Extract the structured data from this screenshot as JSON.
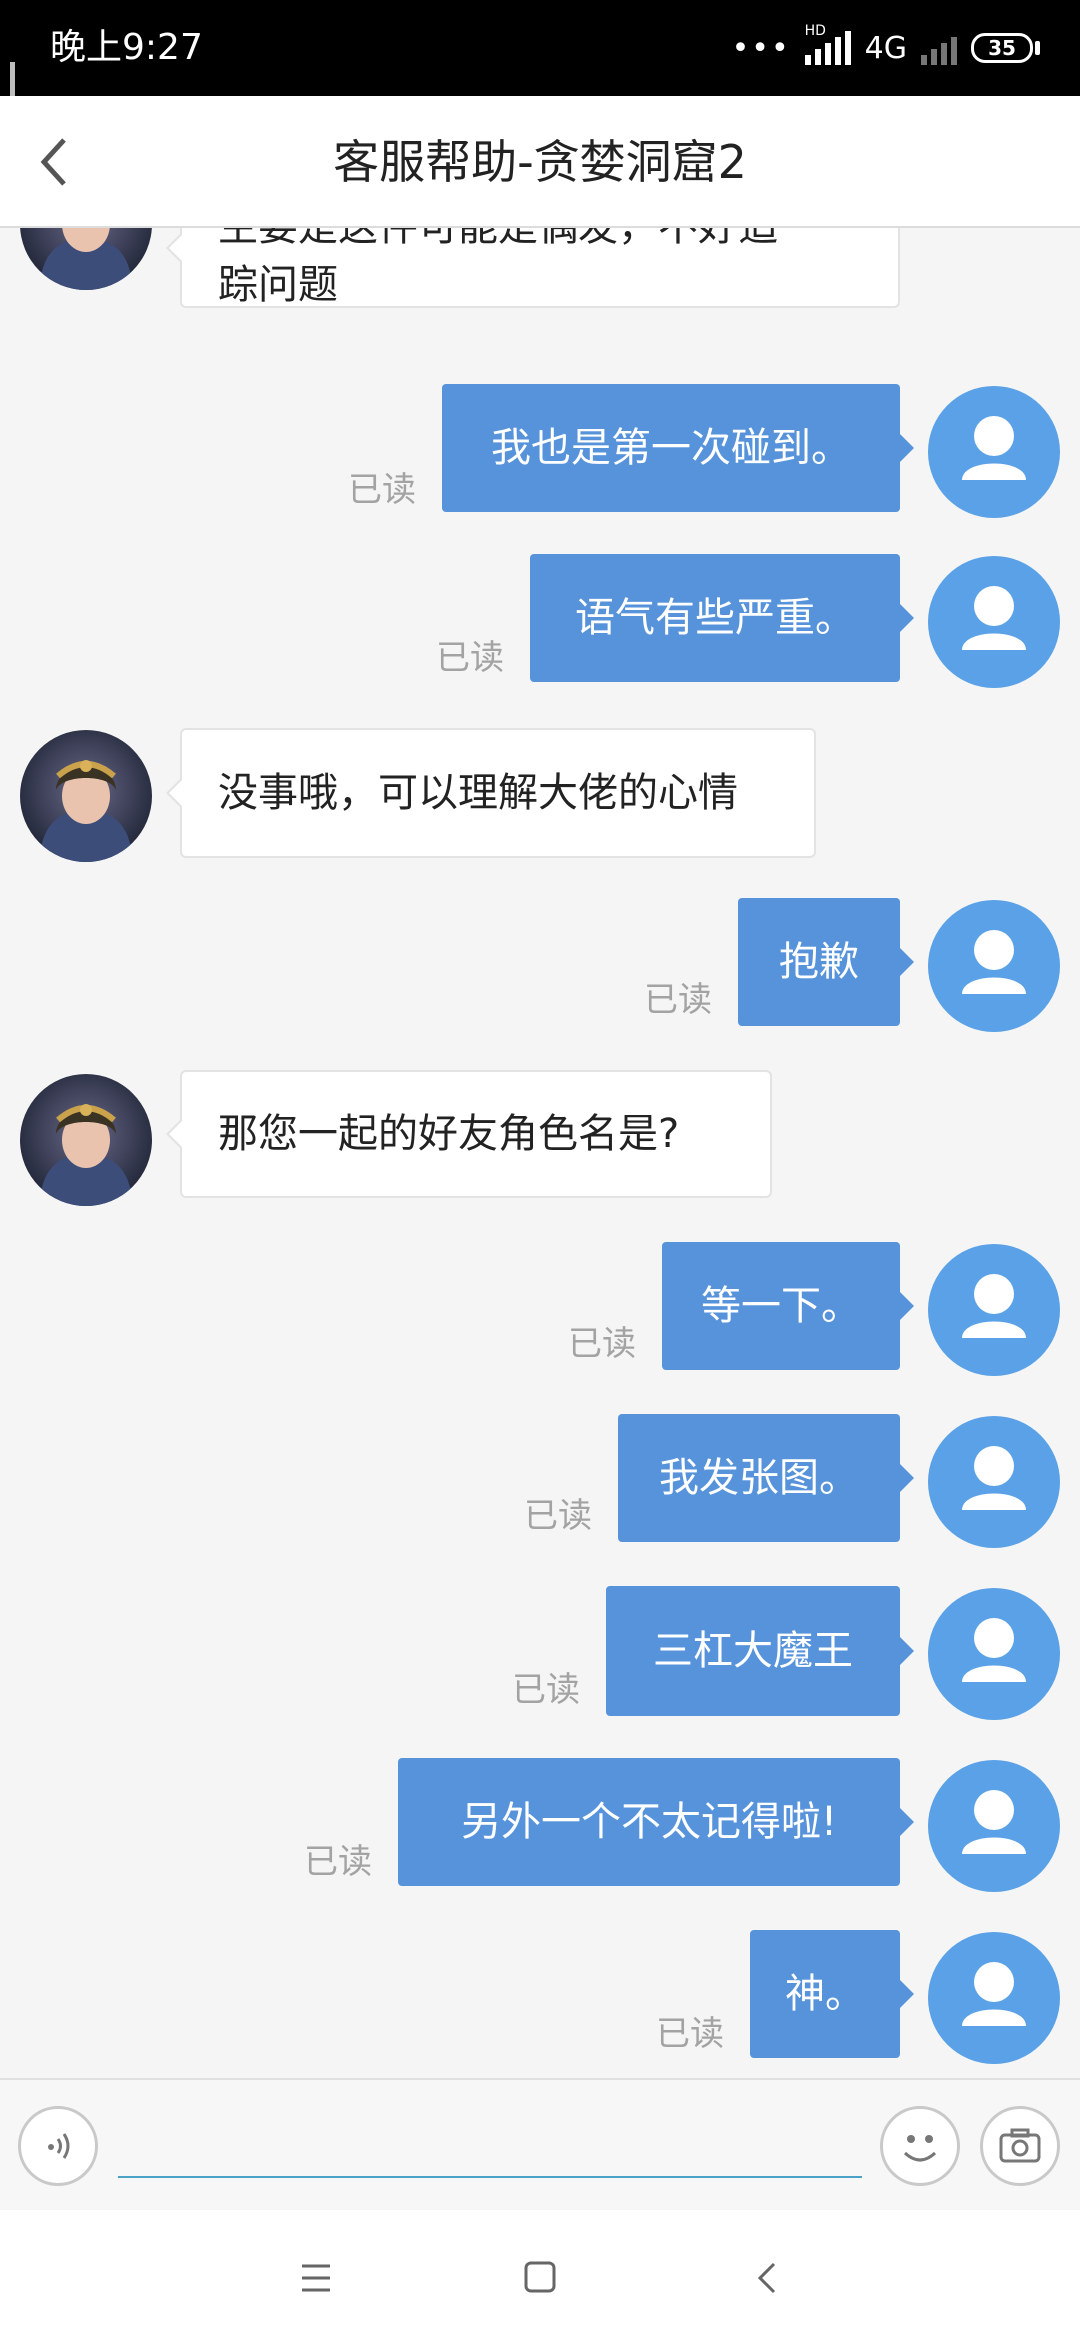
{
  "status_bar": {
    "time": "晚上9:27",
    "hd_label": "HD",
    "network": "4G",
    "battery": "35"
  },
  "header": {
    "title": "客服帮助-贪婪洞窟2",
    "back_icon": "chevron-left-icon"
  },
  "messages": [
    {
      "sender": "agent",
      "lines": [
        "主要是这件可能是偶发，不好追",
        "踪问题"
      ]
    },
    {
      "sender": "user",
      "text": "我也是第一次碰到。",
      "status": "已读"
    },
    {
      "sender": "user",
      "text": "语气有些严重。",
      "status": "已读"
    },
    {
      "sender": "agent",
      "text": "没事哦，可以理解大佬的心情"
    },
    {
      "sender": "user",
      "text": "抱歉",
      "status": "已读"
    },
    {
      "sender": "agent",
      "text": "那您一起的好友角色名是?"
    },
    {
      "sender": "user",
      "text": "等一下。",
      "status": "已读"
    },
    {
      "sender": "user",
      "text": "我发张图。",
      "status": "已读"
    },
    {
      "sender": "user",
      "text": "三杠大魔王",
      "status": "已读"
    },
    {
      "sender": "user",
      "text": "另外一个不太记得啦!",
      "status": "已读"
    },
    {
      "sender": "user",
      "text": "神。",
      "status": "已读"
    }
  ],
  "input_bar": {
    "value": "",
    "voice_icon": "voice-icon",
    "emoji_icon": "emoji-icon",
    "camera_icon": "camera-icon"
  },
  "nav_bar": {
    "menu_icon": "menu-icon",
    "home_icon": "home-icon",
    "back_icon": "back-icon"
  },
  "colors": {
    "sent_bubble": "#5793db",
    "user_avatar": "#5aa1e7",
    "status_bar": "#000000",
    "input_underline": "#4aa3c7"
  }
}
